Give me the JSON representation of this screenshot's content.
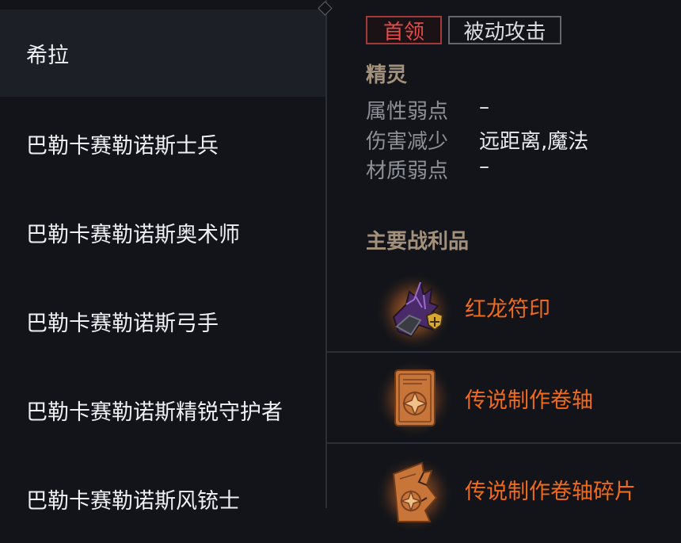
{
  "monster_list": [
    {
      "name": "希拉",
      "selected": true
    },
    {
      "name": "巴勒卡赛勒诺斯士兵",
      "selected": false
    },
    {
      "name": "巴勒卡赛勒诺斯奥术师",
      "selected": false
    },
    {
      "name": "巴勒卡赛勒诺斯弓手",
      "selected": false
    },
    {
      "name": "巴勒卡赛勒诺斯精锐守护者",
      "selected": false
    },
    {
      "name": "巴勒卡赛勒诺斯风铳士",
      "selected": false
    }
  ],
  "detail": {
    "tags": {
      "boss": "首领",
      "passive": "被动攻击"
    },
    "race": "精灵",
    "stats": [
      {
        "label": "属性弱点",
        "value": "–"
      },
      {
        "label": "伤害减少",
        "value": "远距离,魔法"
      },
      {
        "label": "材质弱点",
        "value": "–"
      }
    ],
    "loot_title": "主要战利品",
    "loot": [
      {
        "name": "红龙符印",
        "icon": "red-dragon-seal-icon"
      },
      {
        "name": "传说制作卷轴",
        "icon": "legendary-scroll-icon"
      },
      {
        "name": "传说制作卷轴碎片",
        "icon": "legendary-scroll-fragment-icon"
      }
    ]
  },
  "colors": {
    "background": "#121419",
    "selected_row": "#1c1f25",
    "boss_tag": "#e44a48",
    "section_title": "#a3917b",
    "loot_name": "#ee6a1c"
  }
}
